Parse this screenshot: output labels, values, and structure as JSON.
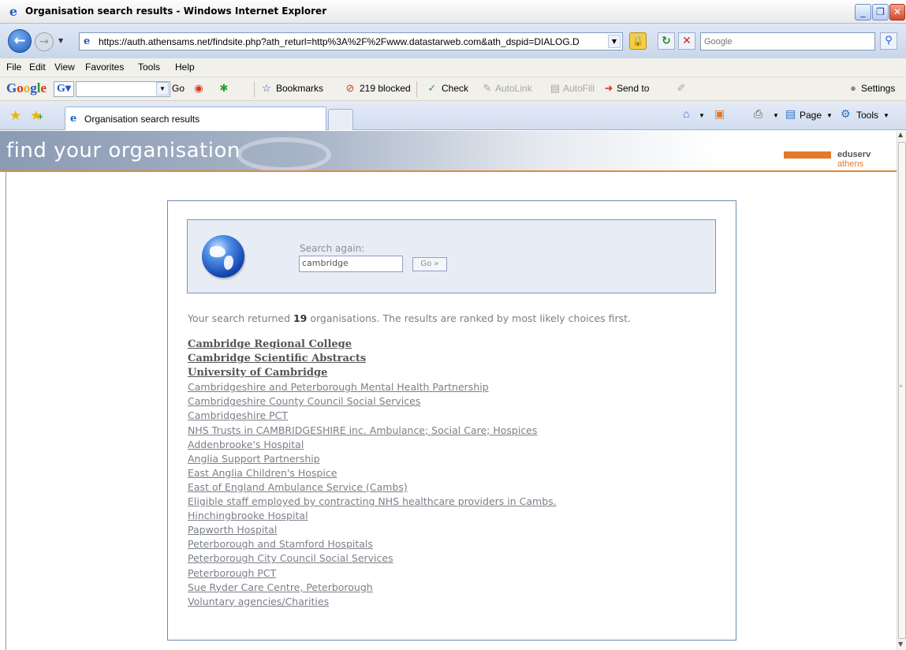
{
  "window": {
    "title": "Organisation search results - Windows Internet Explorer",
    "min": "_",
    "max": "❐",
    "close": "✕"
  },
  "address": {
    "url": "https://auth.athensams.net/findsite.php?ath_returl=http%3A%2F%2Fwww.datastarweb.com&ath_dspid=DIALOG.D",
    "search_placeholder": "Google"
  },
  "menu": [
    "File",
    "Edit",
    "View",
    "Favorites",
    "Tools",
    "Help"
  ],
  "google_toolbar": {
    "go": "Go",
    "bookmarks": "Bookmarks",
    "blocked": "219 blocked",
    "check": "Check",
    "autolink": "AutoLink",
    "autofill": "AutoFill",
    "send_to": "Send to",
    "settings": "Settings"
  },
  "tabs": {
    "active_label": "Organisation search results",
    "page": "Page",
    "tools": "Tools"
  },
  "header": {
    "find_text": "find your organisation",
    "brand_main": "eduserv",
    "brand_sub": "athens"
  },
  "search": {
    "label": "Search again:",
    "value": "cambridge",
    "go_label": "Go »"
  },
  "summary": {
    "prefix": "Your search returned ",
    "count": "19",
    "suffix": " organisations. The results are ranked by most likely choices first."
  },
  "results": {
    "top": [
      "Cambridge Regional College",
      "Cambridge Scientific Abstracts",
      "University of Cambridge"
    ],
    "rest": [
      "Cambridgeshire and Peterborough Mental Health Partnership",
      "Cambridgeshire County Council Social Services",
      "Cambridgeshire PCT",
      "NHS Trusts in CAMBRIDGESHIRE inc. Ambulance; Social Care; Hospices",
      "Addenbrooke's Hospital",
      "Anglia Support Partnership",
      "East Anglia Children's Hospice",
      "East of England Ambulance Service (Cambs)",
      "Eligible staff employed by contracting NHS healthcare providers in Cambs.",
      "Hinchingbrooke Hospital",
      "Papworth Hospital",
      "Peterborough and Stamford Hospitals",
      "Peterborough City Council Social Services",
      "Peterborough PCT",
      "Sue Ryder Care Centre, Peterborough",
      "Voluntary agencies/Charities"
    ]
  }
}
